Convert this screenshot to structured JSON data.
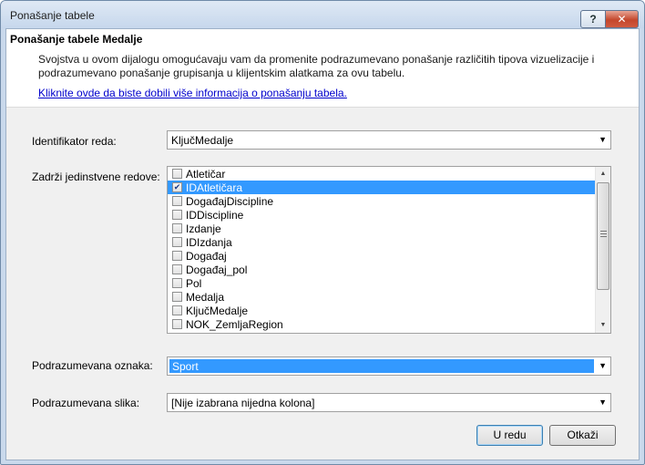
{
  "window": {
    "title": "Ponašanje tabele",
    "help_label": "?",
    "close_label": "✕"
  },
  "header": {
    "title": "Ponašanje tabele Medalje",
    "description": "Svojstva u ovom dijalogu omogućavaju vam da promenite podrazumevano ponašanje različitih tipova vizuelizacije i podrazumevano ponašanje grupisanja u klijentskim alatkama za ovu tabelu.",
    "link": "Kliknite ovde da biste dobili više informacija o ponašanju tabela."
  },
  "row_identifier": {
    "label": "Identifikator reda:",
    "value": "KljučMedalje"
  },
  "keep_unique_rows": {
    "label": "Zadrži jedinstvene redove:",
    "items": [
      {
        "label": "Atletičar",
        "checked": false,
        "selected": false
      },
      {
        "label": "IDAtletičara",
        "checked": true,
        "selected": true
      },
      {
        "label": "DogađajDiscipline",
        "checked": false,
        "selected": false
      },
      {
        "label": "IDDiscipline",
        "checked": false,
        "selected": false
      },
      {
        "label": "Izdanje",
        "checked": false,
        "selected": false
      },
      {
        "label": "IDIzdanja",
        "checked": false,
        "selected": false
      },
      {
        "label": "Događaj",
        "checked": false,
        "selected": false
      },
      {
        "label": "Događaj_pol",
        "checked": false,
        "selected": false
      },
      {
        "label": "Pol",
        "checked": false,
        "selected": false
      },
      {
        "label": "Medalja",
        "checked": false,
        "selected": false
      },
      {
        "label": "KljučMedalje",
        "checked": false,
        "selected": false
      },
      {
        "label": "NOK_ZemljaRegion",
        "checked": false,
        "selected": false
      }
    ]
  },
  "default_label": {
    "label": "Podrazumevana oznaka:",
    "value": "Sport"
  },
  "default_image": {
    "label": "Podrazumevana slika:",
    "value": "[Nije izabrana nijedna kolona]"
  },
  "buttons": {
    "ok": "U redu",
    "cancel": "Otkaži"
  },
  "colors": {
    "selection": "#3399ff",
    "close_button": "#c4472c",
    "link": "#0000cc"
  },
  "icons": {
    "dropdown": "chevron-down-icon",
    "check": "checkmark-icon"
  }
}
